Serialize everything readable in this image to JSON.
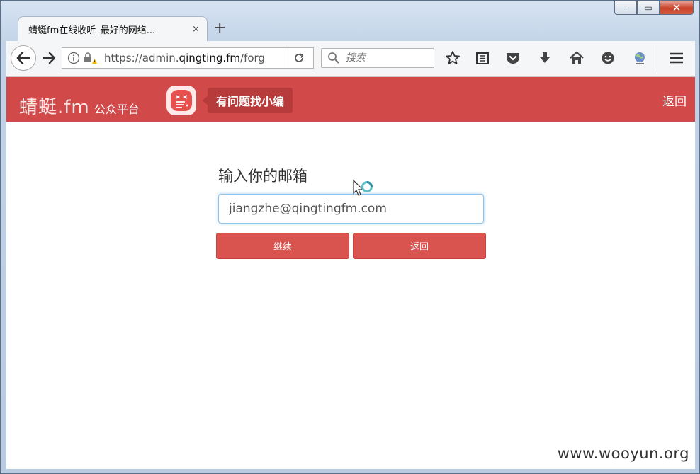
{
  "browser": {
    "tab_title": "蜻蜓fm在线收听_最好的网络...",
    "tab_close": "×",
    "new_tab": "+",
    "url_prefix": "https://admin.",
    "url_host": "qingting.fm",
    "url_suffix": "/forg",
    "search_placeholder": "搜索",
    "window_controls": {
      "minimize": "–",
      "restore": "▭",
      "close": "✕"
    }
  },
  "site": {
    "logo_main": "蜻蜓.fm",
    "logo_sub": "公众平台",
    "help_label": "有问题找小编",
    "header_back": "返回",
    "brand_color": "#d2494a"
  },
  "form": {
    "label": "输入你的邮箱",
    "email_value": "jiangzhe@qingtingfm.com",
    "continue_label": "继续",
    "back_label": "返回"
  },
  "watermark": "www.wooyun.org"
}
